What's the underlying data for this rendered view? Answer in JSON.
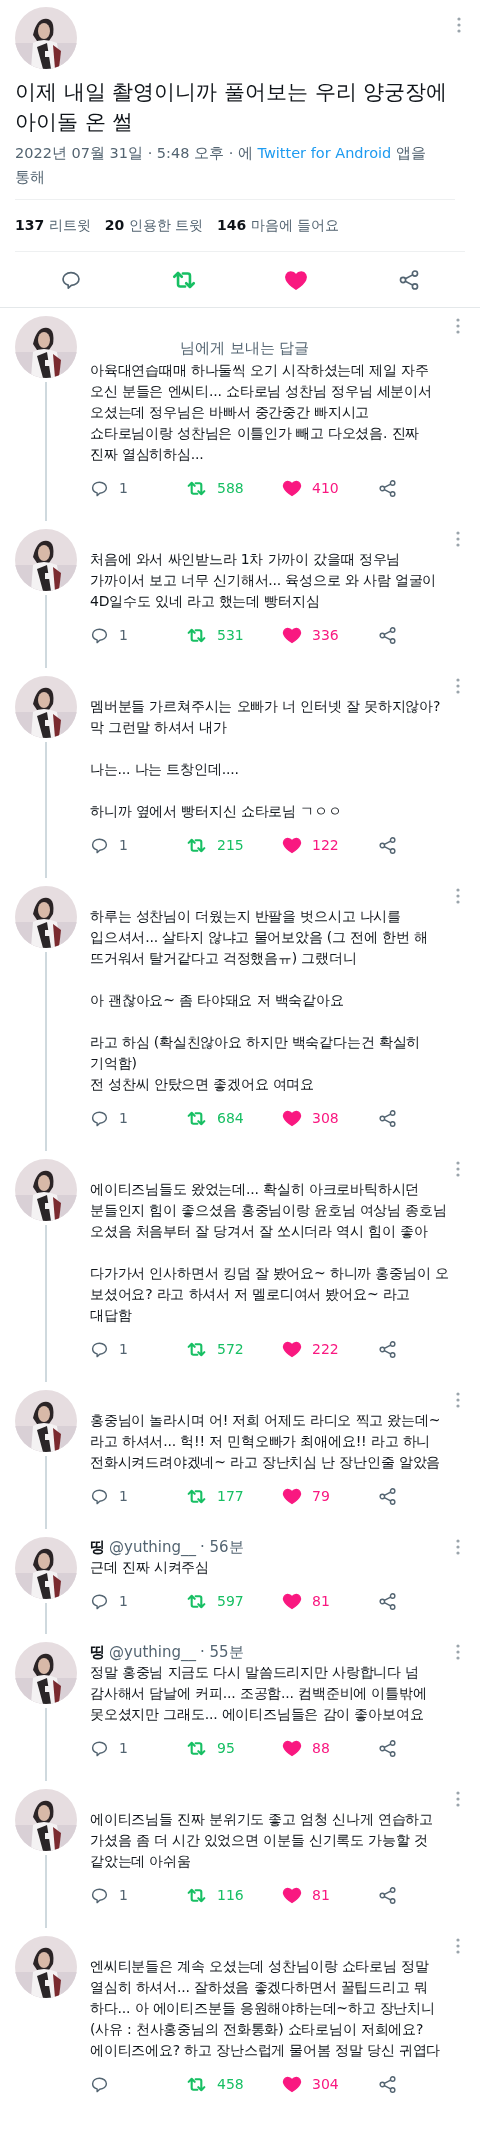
{
  "main_tweet": {
    "text": "이제 내일 촬영이니까 풀어보는 우리 양궁장에 아이돌 온 썰",
    "timestamp": "2022년 07월 31일 · 5:48 오후 · 에",
    "source": "Twitter for Android",
    "source_suffix": "앱을 통해",
    "stats": [
      "**137** 리트윗",
      "**20** 인용한 트윗",
      "**146** 마음에 들어요"
    ],
    "retweeted": true,
    "liked": true
  },
  "replies": [
    {
      "reply_to": "님에게 보내는 답글",
      "text": "아육대연습때매 하나둘씩 오기 시작하셨는데 제일 자주\n오신 분들은 엔씨티... 쇼타로님 성찬님 정우님 세분이서\n오셨는데 정우님은 바빠서 중간중간 빠지시고\n쇼타로님이랑 성찬님은 이틀인가 빼고 다오셨음. 진짜\n진짜 열심히하심...",
      "reply_count": "1",
      "retweet_count": "588",
      "like_count": "410",
      "retweeted": true,
      "liked": true
    },
    {
      "text": "처음에 와서 싸인받느라 1차 가까이 갔을때 정우님\n가까이서 보고 너무 신기해서... 육성으로 와 사람 얼굴이\n4D일수도 있네 라고 했는데 빵터지심",
      "reply_count": "1",
      "retweet_count": "531",
      "like_count": "336",
      "retweeted": true,
      "liked": true
    },
    {
      "text": "멤버분들 가르쳐주시는 오빠가 너 인터넷 잘 못하지않아?\n막 그런말 하셔서 내가\n\n나는... 나는 트창인데....\n\n하니까 옆에서 빵터지신 쇼타로님 ㄱㅇㅇ",
      "reply_count": "1",
      "retweet_count": "215",
      "like_count": "122",
      "retweeted": true,
      "liked": true
    },
    {
      "text": "하루는 성찬님이 더웠는지 반팔을 벗으시고 나시를\n입으셔서... 살타지 않냐고 물어보았음 (그 전에 한번 해\n뜨거워서 탈거같다고 걱정했음ㅠ) 그랬더니\n\n아 괜찮아요~ 좀 타야돼요 저 백숙같아요\n\n라고 하심 (확실친않아요 하지만 백숙같다는건 확실히\n기억함)\n전 성찬씨 안탔으면 좋겠어요 여며요",
      "reply_count": "1",
      "retweet_count": "684",
      "like_count": "308",
      "retweeted": true,
      "liked": true
    },
    {
      "text": "에이티즈님들도 왔었는데... 확실히 아크로바틱하시던\n분들인지 힘이 좋으셨음 홍중님이랑 윤호님 여상님 종호님\n오셨음 처음부터 잘 당겨서 잘 쏘시더라 역시 힘이 좋아\n\n다가가서 인사하면서 킹덤 잘 봤어요~ 하니까 홍중님이 오\n보셨어요? 라고 하셔서 저 멜로디여서 봤어요~ 라고\n대답함",
      "reply_count": "1",
      "retweet_count": "572",
      "like_count": "222",
      "retweeted": true,
      "liked": true
    },
    {
      "text": "홍중님이 놀라시며 어! 저희 어제도 라디오 찍고 왔는데~\n라고 하셔서... 헉!! 저 민혁오빠가 최애에요!! 라고 하니\n전화시켜드려야겠네~ 라고 장난치심 난 장난인줄 알았음",
      "reply_count": "1",
      "retweet_count": "177",
      "like_count": "79",
      "retweeted": true,
      "liked": true
    },
    {
      "author": {
        "name": "띵",
        "handle": "@yuthing__",
        "time": "· 56분"
      },
      "text": "근데 진짜 시켜주심",
      "reply_count": "1",
      "retweet_count": "597",
      "like_count": "81",
      "retweeted": true,
      "liked": true
    },
    {
      "author": {
        "name": "띵",
        "handle": "@yuthing__",
        "time": "· 55분"
      },
      "text": "정말 홍중님 지금도 다시 말씀드리지만 사랑합니다 넘\n감사해서 담날에 커피... 조공함... 컴백준비에 이틀밖에\n못오셨지만 그래도... 에이티즈님들은 감이 좋아보여요",
      "reply_count": "1",
      "retweet_count": "95",
      "like_count": "88",
      "retweeted": true,
      "liked": true
    },
    {
      "text": "에이티즈님들 진짜 분위기도 좋고 엄청 신나게 연습하고\n가셨음 좀 더 시간 있었으면 이분들 신기록도 가능할 것\n같았는데 아쉬움",
      "reply_count": "1",
      "retweet_count": "116",
      "like_count": "81",
      "retweeted": true,
      "liked": true
    },
    {
      "text": "엔씨티분들은 계속 오셨는데 성찬님이랑 쇼타로님 정말\n열심히 하셔서... 잘하셨음 좋겠다하면서 꿀팁드리고 뭐\n하다... 아 에이티즈분들 응원해야하는데~하고 장난치니\n(사유 : 천사홍중님의 전화통화) 쇼타로님이 저희에요?\n에이티즈에요? 하고 장난스럽게 물어봄 정말 당신 귀엽다",
      "retweet_count": "458",
      "like_count": "304",
      "retweeted": true,
      "liked": true
    }
  ]
}
